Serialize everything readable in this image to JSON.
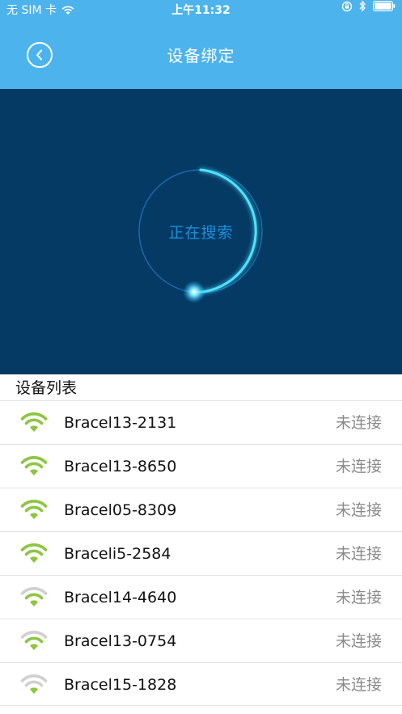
{
  "status_bar": {
    "carrier": "无 SIM 卡",
    "time": "上午11:32"
  },
  "nav": {
    "title": "设备绑定"
  },
  "search": {
    "status_text": "正在搜索"
  },
  "device_list": {
    "title": "设备列表",
    "items": [
      {
        "name": "Bracel13-2131",
        "status": "未连接",
        "signal_color": "#8cc63f"
      },
      {
        "name": "Bracel13-8650",
        "status": "未连接",
        "signal_color": "#8cc63f"
      },
      {
        "name": "Bracel05-8309",
        "status": "未连接",
        "signal_color": "#8cc63f"
      },
      {
        "name": "Braceli5-2584",
        "status": "未连接",
        "signal_color": "#8cc63f"
      },
      {
        "name": "Bracel14-4640",
        "status": "未连接",
        "signal_color": "#8cc63f"
      },
      {
        "name": "Bracel13-0754",
        "status": "未连接",
        "signal_color": "#8cc63f"
      },
      {
        "name": "Bracel15-1828",
        "status": "未连接",
        "signal_color": "#8cc63f"
      }
    ]
  },
  "colors": {
    "header": "#4db3ec",
    "search_background": "#043a63",
    "ring_glow": "#4fe3ff",
    "signal_strong": "#8cc63f",
    "signal_weak": "#d0d0d0"
  }
}
